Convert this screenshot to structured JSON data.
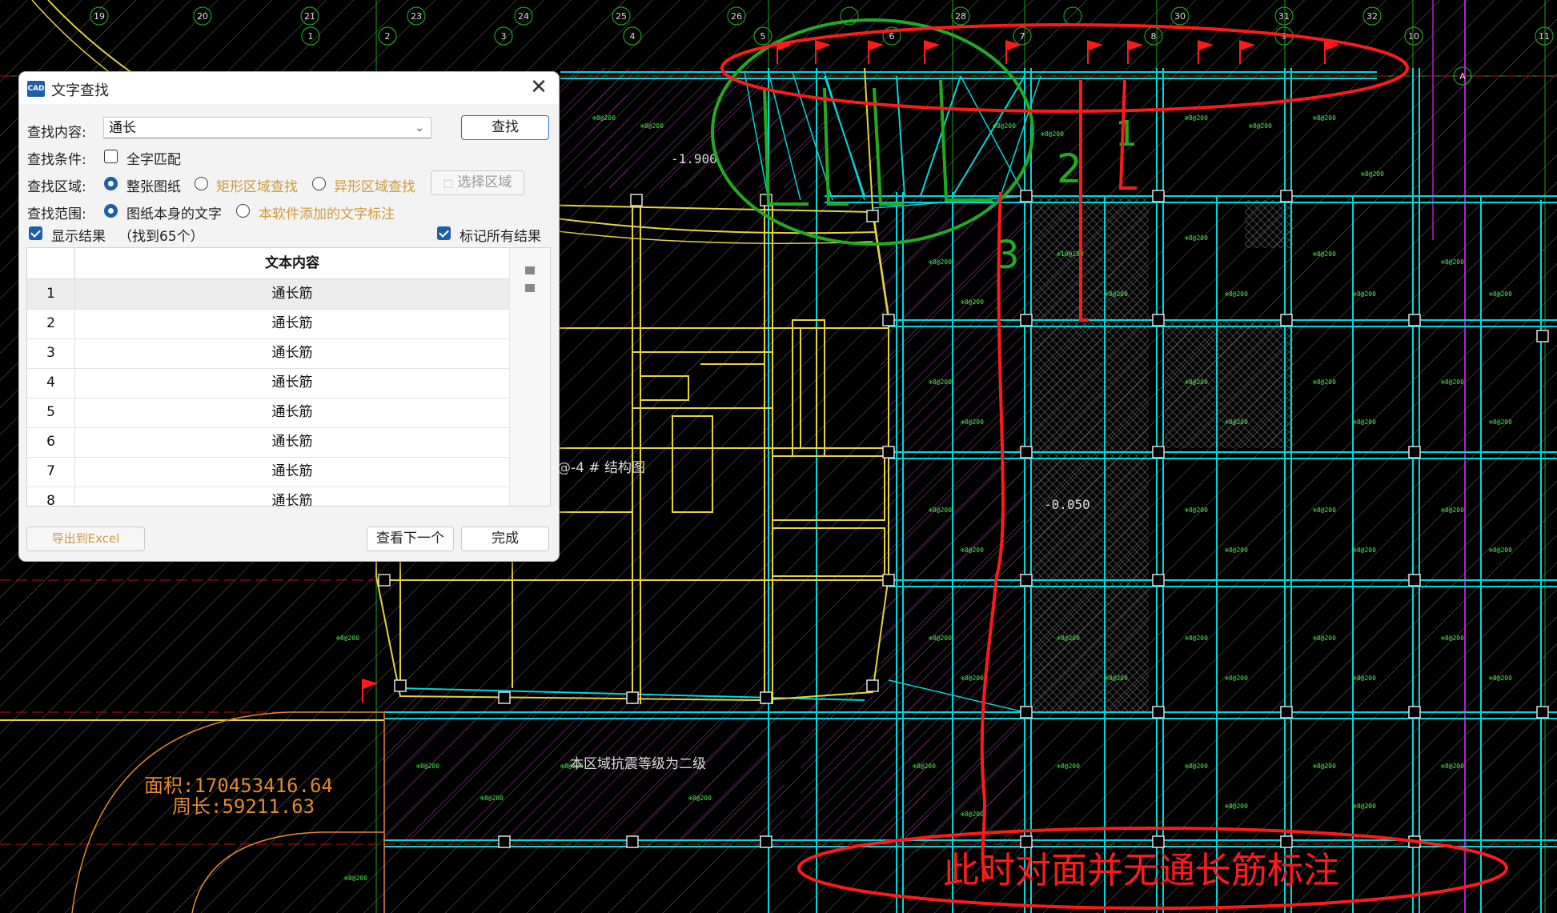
{
  "dialog": {
    "title": "文字查找",
    "app_icon_text": "CAD",
    "close_glyph": "✕",
    "search_label": "查找内容:",
    "search_value": "通长",
    "find_button": "查找",
    "condition_label": "查找条件:",
    "whole_word": {
      "label": "全字匹配",
      "checked": false
    },
    "area_label": "查找区域:",
    "area_options": [
      {
        "label": "整张图纸",
        "selected": true
      },
      {
        "label": "矩形区域查找",
        "selected": false
      },
      {
        "label": "异形区域查找",
        "selected": false
      }
    ],
    "select_area_button": "选择区域",
    "scope_label": "查找范围:",
    "scope_options": [
      {
        "label": "图纸本身的文字",
        "selected": true
      },
      {
        "label": "本软件添加的文字标注",
        "selected": false
      }
    ],
    "show_results": {
      "label": "显示结果",
      "checked": true
    },
    "result_count": "（找到65个）",
    "mark_all": {
      "label": "标记所有结果",
      "checked": true
    },
    "table_header": "文本内容",
    "rows": [
      {
        "idx": "1",
        "text": "通长筋"
      },
      {
        "idx": "2",
        "text": "通长筋"
      },
      {
        "idx": "3",
        "text": "通长筋"
      },
      {
        "idx": "4",
        "text": "通长筋"
      },
      {
        "idx": "5",
        "text": "通长筋"
      },
      {
        "idx": "6",
        "text": "通长筋"
      },
      {
        "idx": "7",
        "text": "通长筋"
      },
      {
        "idx": "8",
        "text": "通长筋"
      }
    ],
    "export_button": "导出到Excel",
    "next_button": "查看下一个",
    "done_button": "完成"
  },
  "drawing": {
    "annotation_note": "此时对面并无通长筋标注",
    "area_text": "面积:170453416.64",
    "perimeter_text": "周长:59211.63",
    "elevation_1": "-1.900",
    "elevation_2": "-0.050",
    "mid_text": "@-4 # 结构图",
    "bottom_text": "本区域抗震等级为二级",
    "marker_1": "1",
    "marker_2": "2",
    "marker_3": "3",
    "axis_labels": [
      "19",
      "20",
      "21",
      "23",
      "24",
      "25",
      "26",
      "28",
      "30",
      "31",
      "32",
      "1",
      "2",
      "3",
      "4",
      "5",
      "6",
      "7",
      "8",
      "9",
      "10",
      "11",
      "A"
    ],
    "colors": {
      "accent_red": "#ff1a1a",
      "green_markup": "#22aa22",
      "cyan_grid": "#00e5e5",
      "yellow_walls": "#e8d840",
      "magenta_hatch": "#c030c0"
    }
  }
}
